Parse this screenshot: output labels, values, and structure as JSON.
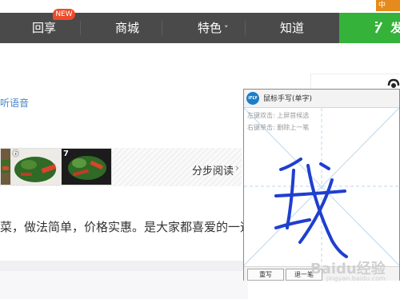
{
  "nav": {
    "items": [
      "回享",
      "商城",
      "特色",
      "知道"
    ],
    "badge": "NEW",
    "features_caret": "˅",
    "action_label": "发",
    "ime_tab": "中"
  },
  "article": {
    "voice_link": "听语音",
    "thumbnails": [
      {
        "number": ""
      },
      {
        "number": "6"
      },
      {
        "number": "7"
      }
    ],
    "step_read": "分步阅读",
    "step_arrow": "›",
    "description": "菜，做法简单，价格实惠。是大家都喜爱的一道"
  },
  "handwriting_panel": {
    "logo": "iFLY",
    "title": "鼠标手写(单字)",
    "help_line1": "左键双击: 上屏首候选",
    "help_line2": "右键单击: 删除上一笔",
    "recognized_char": "我",
    "buttons": [
      "重写",
      "退一笔"
    ]
  },
  "watermark": {
    "text": "Baidu经验",
    "sub": "jingyan.baidu.com"
  },
  "colors": {
    "nav_bg": "#4a4a4a",
    "action_green": "#34b23a",
    "badge_red": "#ee4b2b",
    "ink_blue": "#1f3fcf",
    "link_blue": "#4a86c8"
  }
}
